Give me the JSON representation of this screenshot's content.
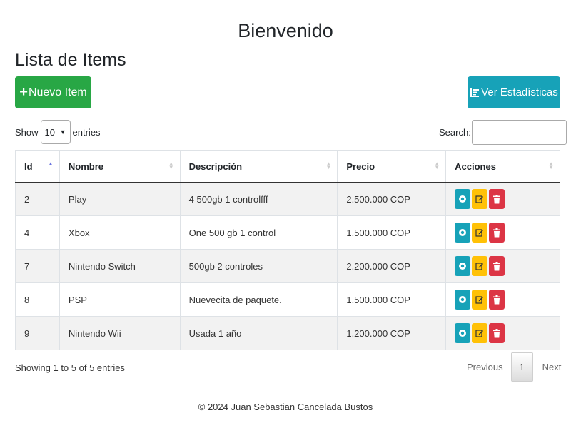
{
  "header": {
    "title": "Bienvenido"
  },
  "list": {
    "title": "Lista de Items",
    "new_button": {
      "icon": "plus-icon",
      "label": "Nuevo Item"
    },
    "stats_button": {
      "icon": "list-icon",
      "label": "Ver Estadísticas"
    }
  },
  "datatable": {
    "length": {
      "prefix": "Show",
      "value": "10",
      "suffix": "entries"
    },
    "search": {
      "label": "Search:",
      "value": "",
      "placeholder": ""
    },
    "columns": [
      "Id",
      "Nombre",
      "Descripción",
      "Precio",
      "Acciones"
    ],
    "sorted_column": "Id",
    "rows": [
      {
        "id": "2",
        "nombre": "Play",
        "descripcion": "4 500gb 1 controlfff",
        "precio": "2.500.000 COP"
      },
      {
        "id": "4",
        "nombre": "Xbox",
        "descripcion": "One 500 gb 1 control",
        "precio": "1.500.000 COP"
      },
      {
        "id": "7",
        "nombre": "Nintendo Switch",
        "descripcion": "500gb 2 controles",
        "precio": "2.200.000 COP"
      },
      {
        "id": "8",
        "nombre": "PSP",
        "descripcion": "Nuevecita de paquete.",
        "precio": "1.500.000 COP"
      },
      {
        "id": "9",
        "nombre": "Nintendo Wii",
        "descripcion": "Usada 1 año",
        "precio": "1.200.000 COP"
      }
    ],
    "row_actions": [
      "view-icon",
      "edit-icon",
      "trash-icon"
    ],
    "info": "Showing 1 to 5 of 5 entries",
    "pagination": {
      "previous": "Previous",
      "current": "1",
      "next": "Next"
    }
  },
  "footer": {
    "text": "© 2024 Juan Sebastian Cancelada Bustos"
  },
  "colors": {
    "success": "#28a745",
    "info": "#17a2b8",
    "warning": "#ffc107",
    "danger": "#dc3545"
  }
}
